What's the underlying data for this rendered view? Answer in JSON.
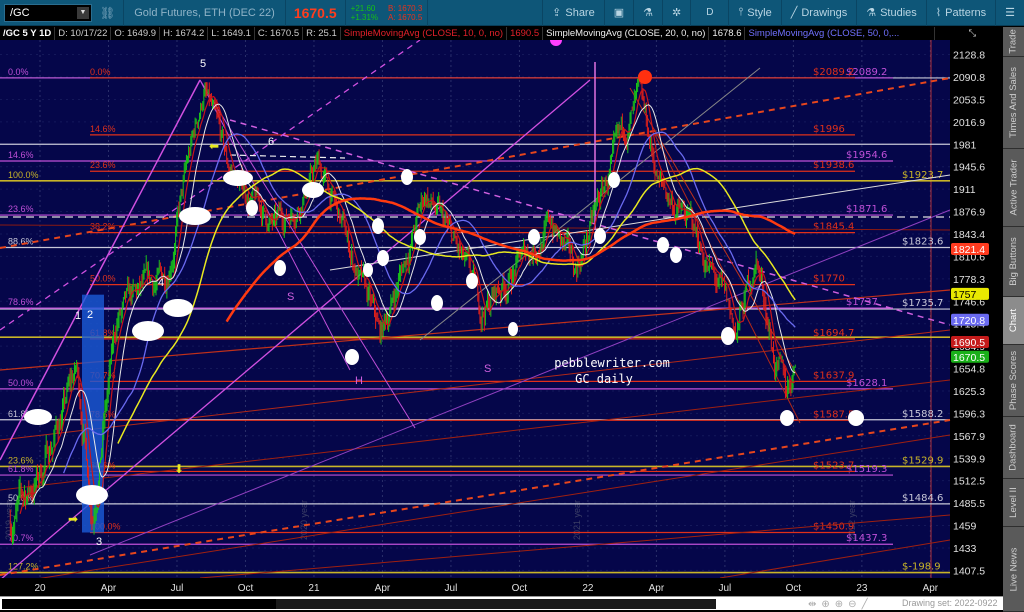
{
  "toolbar": {
    "symbol": "/GC",
    "description": "Gold Futures, ETH (DEC 22)",
    "last": "1670.5",
    "change": "+21.60",
    "change_pct": "+1.31%",
    "bid": "B: 1670.3",
    "ask": "A: 1670.5",
    "share": "Share",
    "aggregation": "D",
    "style": "Style",
    "drawings": "Drawings",
    "studies": "Studies",
    "patterns": "Patterns"
  },
  "legend": {
    "title": "/GC 5 Y 1D",
    "date": "D: 10/17/22",
    "open": "O: 1649.9",
    "high": "H: 1674.2",
    "low": "L: 1649.1",
    "close": "C: 1670.5",
    "range": "R: 25.1",
    "sma10": "SimpleMovingAvg (CLOSE, 10, 0, no)",
    "sma10_val": "1690.5",
    "sma20": "SimpleMovingAvg (CLOSE, 20, 0, no)",
    "sma20_val": "1678.6",
    "sma50": "SimpleMovingAvg (CLOSE, 50, 0,..."
  },
  "price_axis": [
    "2128.8",
    "2090.8",
    "2053.5",
    "2016.9",
    "1981",
    "1945.6",
    "1911",
    "1876.9",
    "1843.4",
    "1810.6",
    "1778.3",
    "1746.6",
    "1715.4",
    "1684.9",
    "1654.8",
    "1625.3",
    "1596.3",
    "1567.9",
    "1539.9",
    "1512.5",
    "1485.5",
    "1459",
    "1433",
    "1407.5"
  ],
  "price_tags": [
    {
      "value": "1821.4",
      "color": "#ff3b1f",
      "text": "#ffffff"
    },
    {
      "value": "1757",
      "color": "#e8e800",
      "text": "#000000"
    },
    {
      "value": "1720.8",
      "color": "#6a6af0",
      "text": "#ffffff"
    },
    {
      "value": "1690.5",
      "color": "#c41a1a",
      "text": "#ffffff"
    },
    {
      "value": "1670.5",
      "color": "#19b019",
      "text": "#ffffff"
    }
  ],
  "time_axis": [
    {
      "label": "20",
      "month": 0
    },
    {
      "label": "Apr",
      "month": 3
    },
    {
      "label": "Jul",
      "month": 6
    },
    {
      "label": "Oct",
      "month": 9
    },
    {
      "label": "21",
      "month": 12
    },
    {
      "label": "Apr",
      "month": 15
    },
    {
      "label": "Jul",
      "month": 18
    },
    {
      "label": "Oct",
      "month": 21
    },
    {
      "label": "22",
      "month": 24
    },
    {
      "label": "Apr",
      "month": 27
    },
    {
      "label": "Jul",
      "month": 30
    },
    {
      "label": "Oct",
      "month": 33
    },
    {
      "label": "23",
      "month": 36
    },
    {
      "label": "Apr",
      "month": 39
    }
  ],
  "year_markers": [
    "2019 year",
    "2020 year",
    "2021 year",
    "2022 year"
  ],
  "levels": {
    "red_fib": [
      {
        "pct": "0.0%",
        "price": 2089.2,
        "label": "$2089.2"
      },
      {
        "pct": "14.6%",
        "price": 1996,
        "label": "$1996"
      },
      {
        "pct": "23.6%",
        "price": 1938.6,
        "label": "$1938.6"
      },
      {
        "pct": "38.2%",
        "price": 1845.4,
        "label": "$1845.4"
      },
      {
        "pct": "50.0%",
        "price": 1770,
        "label": "$1770"
      },
      {
        "pct": "61.8%",
        "price": 1694.7,
        "label": "$1694.7"
      },
      {
        "pct": "70.7%",
        "price": 1637.9,
        "label": "$1637.9"
      },
      {
        "pct": "78.6%",
        "price": 1587.5,
        "label": "$1587.5"
      },
      {
        "pct": "88.6%",
        "price": 1523.7,
        "label": "$1523.7"
      },
      {
        "pct": "100.0%",
        "price": 1450.9,
        "label": "$1450.9"
      }
    ],
    "pink_fib": [
      {
        "pct": "0.0%",
        "price": 2089.2,
        "label": "$2089.2"
      },
      {
        "pct": "14.6%",
        "price": 1954.6,
        "label": "$1954.6"
      },
      {
        "pct": "23.6%",
        "price": 1871.6,
        "label": "$1871.6"
      },
      {
        "pct": "78.6%",
        "price": 1737,
        "label": "$1737"
      },
      {
        "pct": "50.0%",
        "price": 1628.1,
        "label": "$1628.1"
      },
      {
        "pct": "61.8%",
        "price": 1519.3,
        "label": "$1519.3"
      },
      {
        "pct": "70.7%",
        "price": 1437.3,
        "label": "$1437.3"
      }
    ],
    "white_fib": [
      {
        "pct": "",
        "price": 2089.2,
        "label": ""
      },
      {
        "pct": "",
        "price": 1981,
        "label": ""
      },
      {
        "pct": "88.6%",
        "price": 1823.6,
        "label": "$1823.6"
      },
      {
        "pct": "",
        "price": 1735.7,
        "label": "$1735.7"
      },
      {
        "pct": "61.8%",
        "price": 1588.2,
        "label": "$1588.2"
      },
      {
        "pct": "50.0%",
        "price": 1484.6,
        "label": "$1484.6"
      }
    ],
    "yellow_fib": [
      {
        "pct": "100.0%",
        "price": 1923.7,
        "label": "$1923.7"
      },
      {
        "pct": "",
        "price": 1697,
        "label": ""
      },
      {
        "pct": "23.6%",
        "price": 1529.9,
        "label": "$1529.9"
      },
      {
        "pct": "127.2%",
        "price": 1405,
        "label": "$-198.9"
      }
    ]
  },
  "annotations": [
    "5",
    "6",
    "4",
    "1",
    "2",
    "3",
    "S",
    "H",
    "S"
  ],
  "watermark": {
    "line1": "pebblewriter.com",
    "line2": "GC daily"
  },
  "chart_data": {
    "type": "candlestick",
    "symbol": "/GC",
    "aggregation": "1D",
    "approx_close_path": [
      {
        "month": -1.3,
        "price": 1465
      },
      {
        "month": 0,
        "price": 1520
      },
      {
        "month": 1.6,
        "price": 1650
      },
      {
        "month": 2.3,
        "price": 1480
      },
      {
        "month": 3.4,
        "price": 1720
      },
      {
        "month": 5.5,
        "price": 1780
      },
      {
        "month": 7.2,
        "price": 2070
      },
      {
        "month": 8.2,
        "price": 1940
      },
      {
        "month": 10.3,
        "price": 1850
      },
      {
        "month": 11.0,
        "price": 1880
      },
      {
        "month": 12.2,
        "price": 1950
      },
      {
        "month": 14.9,
        "price": 1690
      },
      {
        "month": 16.9,
        "price": 1905
      },
      {
        "month": 18.3,
        "price": 1810
      },
      {
        "month": 19.3,
        "price": 1730
      },
      {
        "month": 22.4,
        "price": 1860
      },
      {
        "month": 23.4,
        "price": 1785
      },
      {
        "month": 26.2,
        "price": 2050
      },
      {
        "month": 27.1,
        "price": 1920
      },
      {
        "month": 28.6,
        "price": 1850
      },
      {
        "month": 30.5,
        "price": 1700
      },
      {
        "month": 31.4,
        "price": 1810
      },
      {
        "month": 32.3,
        "price": 1650
      },
      {
        "month": 32.7,
        "price": 1620
      },
      {
        "month": 33.1,
        "price": 1670.5
      }
    ],
    "ylim": [
      1400,
      2140
    ],
    "scale": "log"
  },
  "sidebar": [
    "Trade",
    "Times And Sales",
    "Active Trader",
    "Big Buttons",
    "Chart",
    "Phase Scores",
    "Dashboard",
    "Level II",
    "Live News"
  ],
  "bottom": {
    "drawing_set": "Drawing set: 2022-0922"
  }
}
